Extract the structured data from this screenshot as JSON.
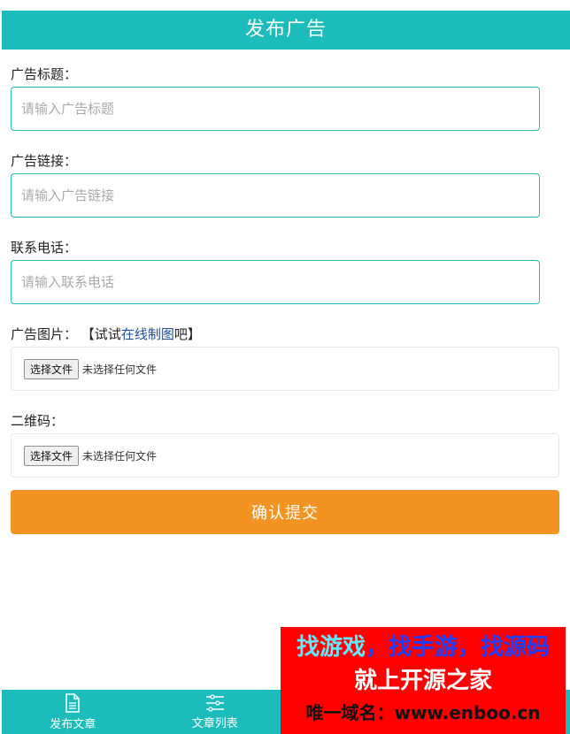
{
  "header": {
    "title": "发布广告"
  },
  "form": {
    "ad_title": {
      "label": "广告标题：",
      "placeholder": "请输入广告标题"
    },
    "ad_link": {
      "label": "广告链接：",
      "placeholder": "请输入广告链接"
    },
    "phone": {
      "label": "联系电话：",
      "placeholder": "请输入联系电话"
    },
    "ad_image": {
      "label": "广告图片：",
      "hint_open": "【试试",
      "hint_link": "在线制图",
      "hint_close": "吧】",
      "file_button": "选择文件",
      "file_status": "未选择任何文件"
    },
    "qrcode": {
      "label": "二维码：",
      "file_button": "选择文件",
      "file_status": "未选择任何文件"
    },
    "submit_label": "确认提交"
  },
  "bottom_nav": {
    "items": [
      {
        "label": "发布文章",
        "icon": "document-icon"
      },
      {
        "label": "文章列表",
        "icon": "list-icon"
      }
    ]
  },
  "overlay_ad": {
    "part1": "找游戏",
    "sep1": "，",
    "part2": "找手游",
    "sep2": "，",
    "part3": "找源码",
    "line2": "就上开源之家",
    "line3": "唯一域名：www.enboo.cn"
  },
  "colors": {
    "primary": "#1cbcbc",
    "submit": "#f39322",
    "overlay": "#ff0000"
  }
}
